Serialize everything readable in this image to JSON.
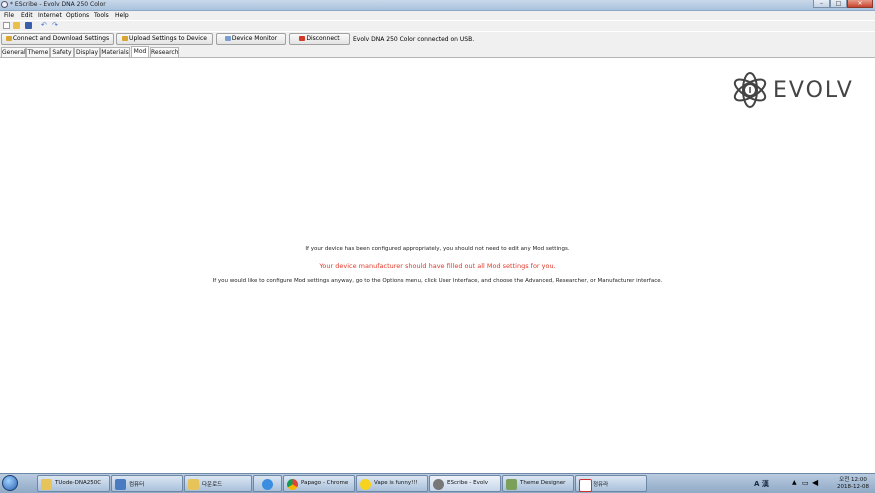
{
  "window": {
    "title": "* EScribe - Evolv DNA 250 Color"
  },
  "menu": [
    "File",
    "Edit",
    "Internet",
    "Options",
    "Tools",
    "Help"
  ],
  "toolbar_icons": [
    "new-file-icon",
    "open-folder-icon",
    "save-icon",
    "undo-icon",
    "redo-icon"
  ],
  "actions": {
    "connect": "Connect and Download Settings",
    "upload": "Upload Settings to Device",
    "monitor": "Device Monitor",
    "disconnect": "Disconnect",
    "status": "Evolv DNA 250 Color connected on USB."
  },
  "tabs": [
    "General",
    "Theme",
    "Safety",
    "Display",
    "Materials",
    "Mod",
    "Research"
  ],
  "active_tab": "Mod",
  "logo_text": "EVOLV",
  "content": {
    "line1": "If your device has been configured appropriately, you should not need to edit any Mod settings.",
    "line2": "Your device manufacturer should have filled out all Mod settings for you.",
    "line3": "If you would like to configure Mod settings anyway, go to the Options menu, click User Interface, and choose the Advanced, Researcher, or Manufacturer interface."
  },
  "taskbar": {
    "items": [
      {
        "label": "TUode-DNA250C"
      },
      {
        "label": "컴퓨터"
      },
      {
        "label": "다운로드"
      },
      {
        "label": ""
      },
      {
        "label": "Papago - Chrome"
      },
      {
        "label": "Vape is funny!!!"
      },
      {
        "label": "EScribe - Evolv"
      },
      {
        "label": "Theme Designer"
      },
      {
        "label": "정유라"
      }
    ],
    "ime": "A 漢",
    "clock_time": "오전 12:00",
    "clock_date": "2018-12-08"
  },
  "colors": {
    "warning_text": "#e03a2a",
    "titlebar": "#b9cde4"
  }
}
